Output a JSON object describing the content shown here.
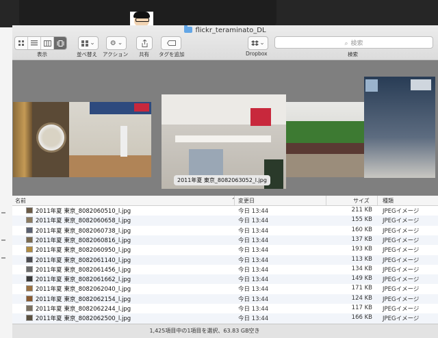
{
  "window": {
    "title": "flickr_teraminato_DL"
  },
  "toolbar": {
    "view_label": "表示",
    "arrange_label": "並べ替え",
    "action_label": "アクション",
    "share_label": "共有",
    "tag_label": "タグを追加",
    "dropbox_label": "Dropbox",
    "search_label": "検索",
    "search_placeholder": "検索"
  },
  "coverflow": {
    "selected_caption": "2011年夏 東京_8082063052_l.jpg"
  },
  "list": {
    "headers": {
      "name": "名前",
      "date": "変更日",
      "size": "サイズ",
      "kind": "種類"
    },
    "rows": [
      {
        "name": "2011年夏 東京_8082060510_l.jpg",
        "date": "今日 13:44",
        "size": "211 KB",
        "kind": "JPEGイメージ"
      },
      {
        "name": "2011年夏 東京_8082060658_l.jpg",
        "date": "今日 13:44",
        "size": "155 KB",
        "kind": "JPEGイメージ"
      },
      {
        "name": "2011年夏 東京_8082060738_l.jpg",
        "date": "今日 13:44",
        "size": "160 KB",
        "kind": "JPEGイメージ"
      },
      {
        "name": "2011年夏 東京_8082060816_l.jpg",
        "date": "今日 13:44",
        "size": "137 KB",
        "kind": "JPEGイメージ"
      },
      {
        "name": "2011年夏 東京_8082060950_l.jpg",
        "date": "今日 13:44",
        "size": "193 KB",
        "kind": "JPEGイメージ"
      },
      {
        "name": "2011年夏 東京_8082061140_l.jpg",
        "date": "今日 13:44",
        "size": "113 KB",
        "kind": "JPEGイメージ"
      },
      {
        "name": "2011年夏 東京_8082061456_l.jpg",
        "date": "今日 13:44",
        "size": "134 KB",
        "kind": "JPEGイメージ"
      },
      {
        "name": "2011年夏 東京_8082061662_l.jpg",
        "date": "今日 13:44",
        "size": "149 KB",
        "kind": "JPEGイメージ"
      },
      {
        "name": "2011年夏 東京_8082062040_l.jpg",
        "date": "今日 13:44",
        "size": "171 KB",
        "kind": "JPEGイメージ"
      },
      {
        "name": "2011年夏 東京_8082062154_l.jpg",
        "date": "今日 13:44",
        "size": "124 KB",
        "kind": "JPEGイメージ"
      },
      {
        "name": "2011年夏 東京_8082062244_l.jpg",
        "date": "今日 13:44",
        "size": "117 KB",
        "kind": "JPEGイメージ"
      },
      {
        "name": "2011年夏 東京_8082062500_l.jpg",
        "date": "今日 13:44",
        "size": "166 KB",
        "kind": "JPEGイメージ"
      }
    ]
  },
  "status": {
    "text": "1,425項目中の1項目を選択、63.83 GB空き"
  },
  "icons": {
    "view_icons": [
      "grid-icon",
      "list-icon",
      "columns-icon",
      "coverflow-icon"
    ],
    "arrange": "arrange-grid-icon",
    "action": "gear-icon",
    "share": "share-icon",
    "tag": "tag-icon",
    "dropbox": "dropbox-icon",
    "search": "magnifier-icon"
  }
}
